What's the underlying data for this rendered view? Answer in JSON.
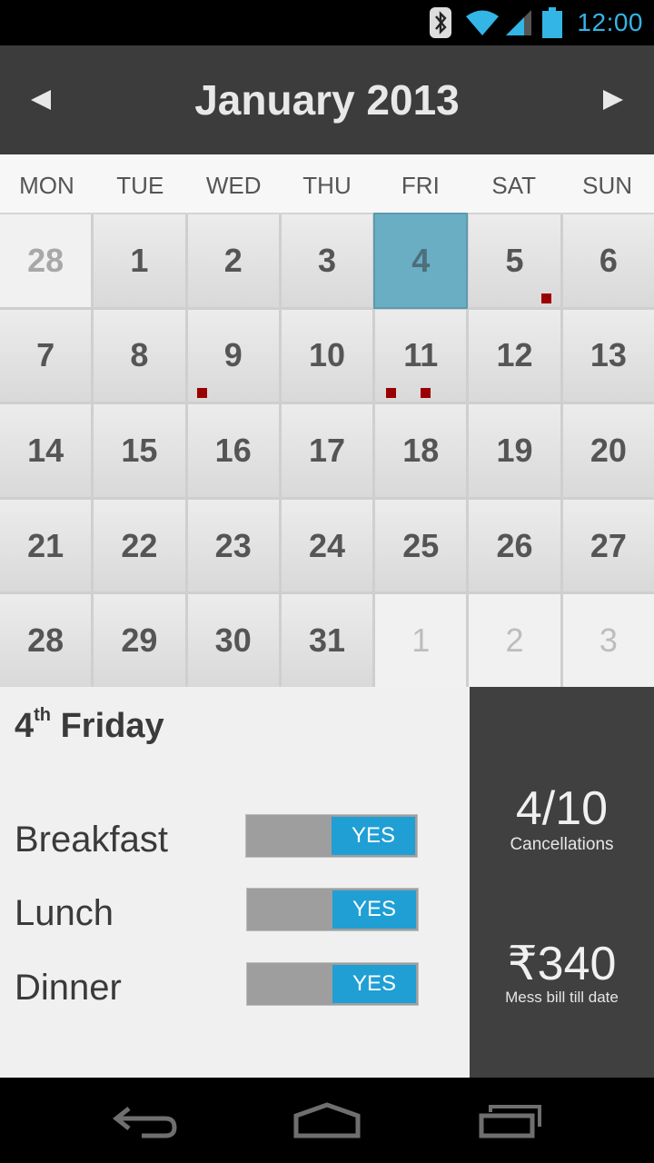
{
  "status": {
    "time": "12:00"
  },
  "header": {
    "title": "January 2013"
  },
  "weekdays": [
    "MON",
    "TUE",
    "WED",
    "THU",
    "FRI",
    "SAT",
    "SUN"
  ],
  "calendar": {
    "days": [
      {
        "label": "28",
        "type": "prev"
      },
      {
        "label": "1"
      },
      {
        "label": "2"
      },
      {
        "label": "3"
      },
      {
        "label": "4",
        "selected": true
      },
      {
        "label": "5",
        "dots": 1
      },
      {
        "label": "6"
      },
      {
        "label": "7"
      },
      {
        "label": "8"
      },
      {
        "label": "9",
        "dots": 1
      },
      {
        "label": "10"
      },
      {
        "label": "11",
        "dots": 2
      },
      {
        "label": "12"
      },
      {
        "label": "13"
      },
      {
        "label": "14"
      },
      {
        "label": "15"
      },
      {
        "label": "16"
      },
      {
        "label": "17"
      },
      {
        "label": "18"
      },
      {
        "label": "19"
      },
      {
        "label": "20"
      },
      {
        "label": "21"
      },
      {
        "label": "22"
      },
      {
        "label": "23"
      },
      {
        "label": "24"
      },
      {
        "label": "25"
      },
      {
        "label": "26"
      },
      {
        "label": "27"
      },
      {
        "label": "28"
      },
      {
        "label": "29"
      },
      {
        "label": "30"
      },
      {
        "label": "31"
      },
      {
        "label": "1",
        "type": "next"
      },
      {
        "label": "2",
        "type": "next"
      },
      {
        "label": "3",
        "type": "next"
      }
    ],
    "dot_color": "#9b0000",
    "selected_color": "#6aaec3"
  },
  "details": {
    "day_number": "4",
    "day_suffix": "th",
    "day_name": "Friday",
    "meals": [
      {
        "label": "Breakfast",
        "toggle": "YES"
      },
      {
        "label": "Lunch",
        "toggle": "YES"
      },
      {
        "label": "Dinner",
        "toggle": "YES"
      }
    ]
  },
  "stats": {
    "cancellations_value": "4/10",
    "cancellations_label": "Cancellations",
    "bill_value": "₹340",
    "bill_label": "Mess bill till date"
  },
  "colors": {
    "accent": "#1f9fd4",
    "header_bg": "#3c3c3c",
    "stats_bg": "#404040"
  }
}
